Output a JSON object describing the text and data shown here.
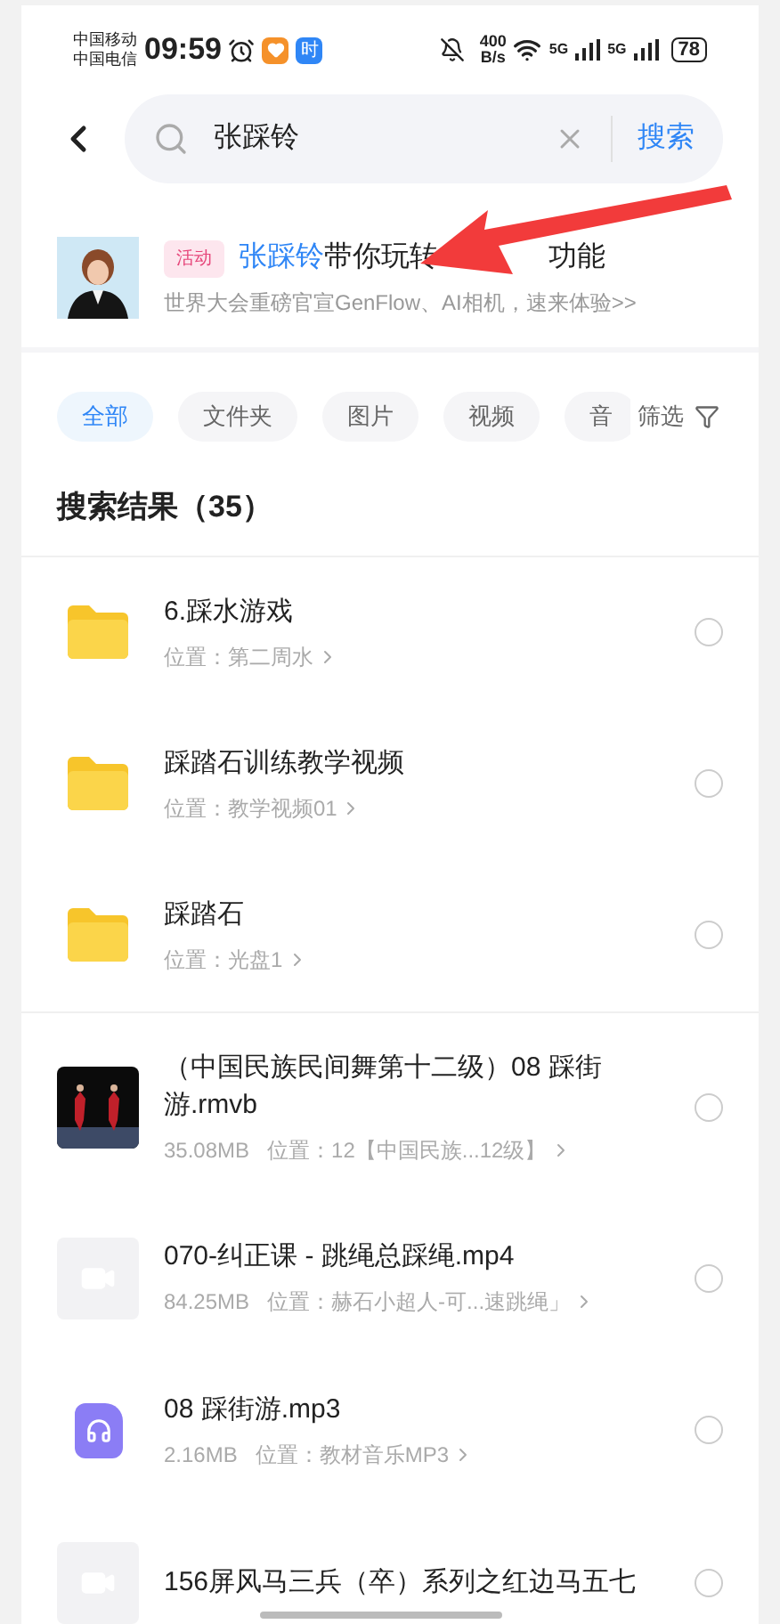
{
  "status_bar": {
    "carriers": [
      "中国移动",
      "中国电信"
    ],
    "time": "09:59",
    "app_badge": "时",
    "speed": "400",
    "speed_unit": "B/s",
    "network_1": "5G",
    "network_2": "5G",
    "battery": "78"
  },
  "search": {
    "value": "张踩铃",
    "button": "搜索"
  },
  "banner": {
    "tag": "活动",
    "highlight": "张踩铃",
    "title_start": "带你玩转",
    "title_end": "功能",
    "subtitle": "世界大会重磅官宣GenFlow、AI相机，速来体验>>"
  },
  "filters": [
    {
      "label": "全部",
      "selected": true
    },
    {
      "label": "文件夹",
      "selected": false
    },
    {
      "label": "图片",
      "selected": false
    },
    {
      "label": "视频",
      "selected": false
    },
    {
      "label": "音",
      "selected": false
    }
  ],
  "filter_button": "筛选",
  "results_heading": "搜索结果（35）",
  "results": [
    {
      "kind": "folder",
      "name": "6.踩水游戏",
      "location": "位置：第二周水",
      "selected": false
    },
    {
      "kind": "folder",
      "name": "踩踏石训练教学视频",
      "location": "位置：教学视频01",
      "selected": false
    },
    {
      "kind": "folder",
      "name": "踩踏石",
      "location": "位置：光盘1",
      "selected": false
    },
    {
      "kind": "picture",
      "name": "（中国民族民间舞第十二级）08 踩街游.rmvb",
      "size": "35.08MB",
      "location": "位置：12【中国民族...12级】",
      "selected": false
    },
    {
      "kind": "video",
      "name": "070-纠正课 - 跳绳总踩绳.mp4",
      "size": "84.25MB",
      "location": "位置：赫石小超人-可...速跳绳」",
      "selected": false
    },
    {
      "kind": "audio",
      "name": "08 踩街游.mp3",
      "size": "2.16MB",
      "location": "位置：教材音乐MP3",
      "selected": false
    },
    {
      "kind": "video",
      "name": "156屏风马三兵（卒）系列之红边马五七",
      "selected": false
    }
  ]
}
